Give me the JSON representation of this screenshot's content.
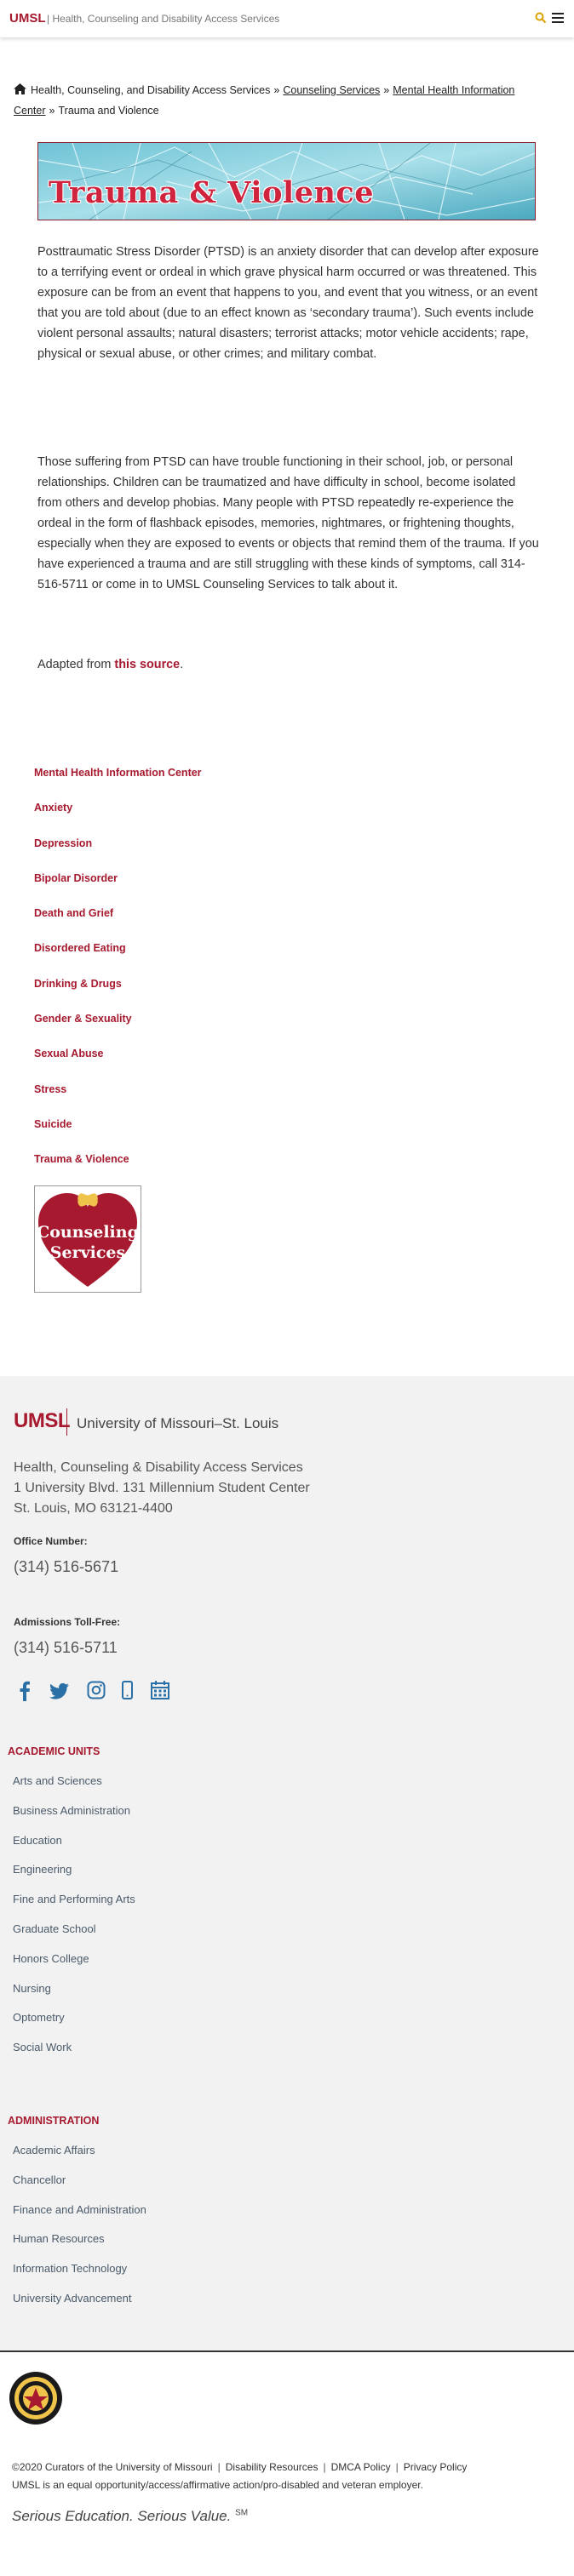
{
  "header": {
    "brand": "UMSL",
    "site_title": "| Health, Counseling and Disability Access Services",
    "search_icon": "search-icon",
    "menu_icon": "hamburger-menu-icon"
  },
  "breadcrumb": {
    "home": "Health, Counseling, and Disability Access Services",
    "sep": "»",
    "items": [
      "Counseling Services",
      "Mental Health Information Center"
    ],
    "current": "Trauma and Violence"
  },
  "banner": {
    "title": "Trauma & Violence"
  },
  "article": {
    "para1": "Posttraumatic Stress Disorder (PTSD) is an anxiety disorder that can develop after exposure to a terrifying event or ordeal in which grave physical harm occurred or was threatened. This exposure can be from an event that happens to you, and event that you witness, or an event that you are told about (due to an effect known as ‘secondary trauma’).  Such events include violent personal assaults; natural disasters; terrorist attacks; motor vehicle accidents; rape, physical or sexual abuse, or other crimes; and military combat.",
    "para2": "Those suffering from PTSD can have trouble functioning in their school, job, or personal relationships. Children can be traumatized and have difficulty in school, become isolated from others and develop phobias. Many people with PTSD repeatedly re-experience the ordeal in the form of flashback episodes, memories, nightmares, or frightening thoughts, especially when they are exposed to events or objects that remind them of the trauma.  If you have experienced a trauma and are still struggling with these kinds of symptoms, call 314-516-5711 or come in to UMSL Counseling Services to talk about it.",
    "adapted_prefix": "Adapted from ",
    "adapted_link": "this source",
    "adapted_suffix": "."
  },
  "side_nav": [
    "Mental Health Information Center",
    "Anxiety",
    "Depression",
    "Bipolar Disorder",
    "Death and Grief",
    "Disordered Eating",
    "Drinking & Drugs",
    "Gender & Sexuality",
    "Sexual Abuse",
    "Stress",
    "Suicide",
    "Trauma & Violence"
  ],
  "counseling_logo": {
    "line1": "Counseling",
    "line2": "Services"
  },
  "footer": {
    "logo": "UMSL",
    "university": "University of Missouri–St. Louis",
    "address": [
      "Health, Counseling & Disability Access Services",
      "1 University Blvd. 131 Millennium Student Center",
      "St. Louis, MO 63121-4400"
    ],
    "office_label": "Office Number:",
    "office_phone": "(314) 516-5671",
    "admissions_label": "Admissions Toll-Free:",
    "admissions_phone": "(314) 516-5711",
    "social_icons": [
      "facebook-icon",
      "twitter-icon",
      "instagram-icon",
      "mobile-icon",
      "calendar-icon"
    ],
    "academic_title": "ACADEMIC UNITS",
    "academic_units": [
      "Arts and Sciences",
      "Business Administration",
      "Education",
      "Engineering",
      "Fine and Performing Arts",
      "Graduate School",
      "Honors College",
      "Nursing",
      "Optometry",
      "Social Work"
    ],
    "admin_title": "ADMINISTRATION",
    "administration": [
      "Academic Affairs",
      "Chancellor",
      "Finance and Administration",
      "Human Resources",
      "Information Technology",
      "University Advancement"
    ]
  },
  "legal": {
    "copyright": "©2020 Curators of the University of Missouri",
    "links": [
      "Disability Resources",
      "DMCA Policy",
      "Privacy Policy"
    ],
    "sep": "|",
    "eeo": "UMSL is an equal opportunity/access/affirmative action/pro-disabled and veteran employer.",
    "tagline": "Serious Education. Serious Value.",
    "tagline_mark": "SM"
  },
  "colors": {
    "brand": "#a6192e",
    "footer_bg": "#f2f2f2"
  }
}
